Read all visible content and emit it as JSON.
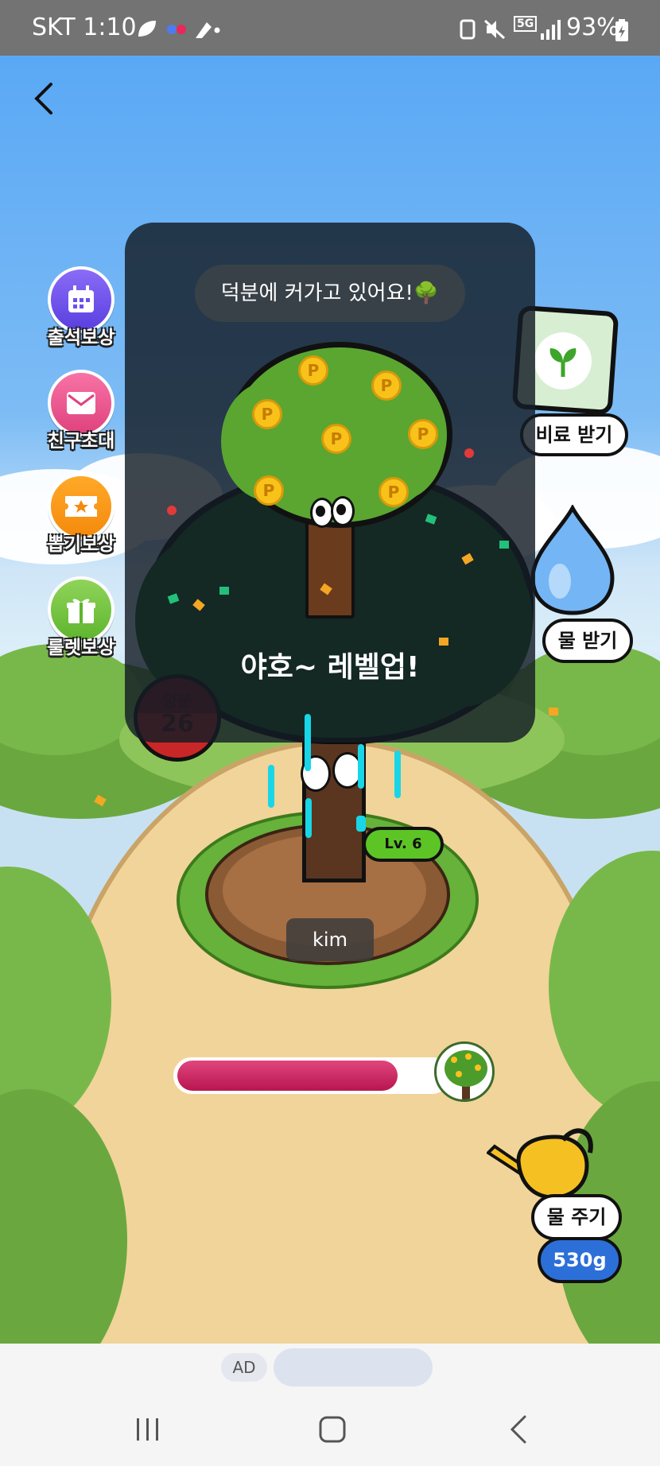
{
  "status_bar": {
    "carrier_time": "SKT 1:10",
    "network": "5G",
    "battery": "93%"
  },
  "menu": {
    "attendance": "출석보상",
    "invite": "친구초대",
    "draw": "뽑기보상",
    "roulette": "룰렛보상"
  },
  "right_actions": {
    "fertilizer": "비료 받기",
    "get_water": "물 받기",
    "give_water": "물 주기",
    "water_amount": "530g"
  },
  "tree": {
    "level": "Lv. 6",
    "owner": "kim",
    "nutrient_label": "양분",
    "nutrient_value": "26",
    "growth_progress": 0.82
  },
  "overlay": {
    "bubble_text": "덕분에 커가고 있어요!🌳",
    "levelup_text": "야호~ 레벨업!"
  },
  "ad": {
    "label": "AD"
  },
  "colors": {
    "progress": "#c81d5d",
    "level_badge": "#5cc525",
    "water_badge": "#2d6fd9"
  }
}
